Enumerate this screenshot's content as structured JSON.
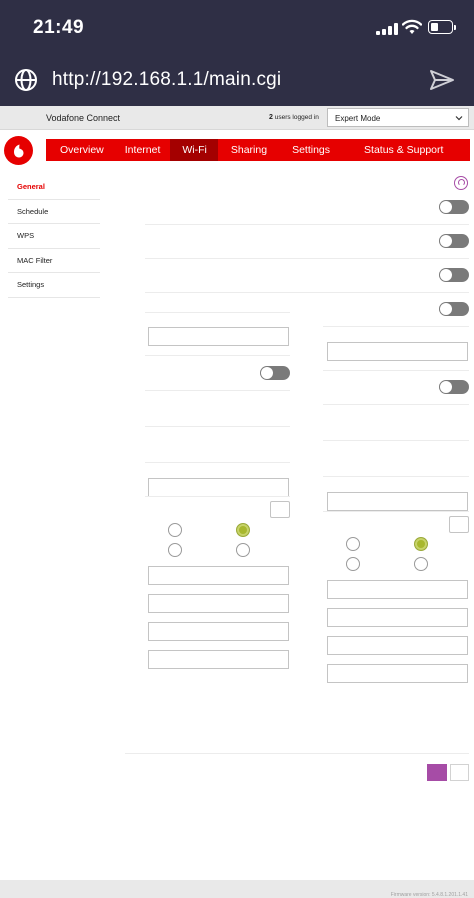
{
  "status_bar": {
    "time": "21:49"
  },
  "browser": {
    "url": "http://192.168.1.1/main.cgi"
  },
  "header": {
    "brand": "Vodafone Connect",
    "users_count": "2",
    "users_text": "users logged in",
    "mode_selected": "Expert Mode"
  },
  "nav": {
    "items": [
      {
        "label": "Overview"
      },
      {
        "label": "Internet"
      },
      {
        "label": "Wi-Fi",
        "active": true
      },
      {
        "label": "Sharing"
      },
      {
        "label": "Settings"
      },
      {
        "label": "Status & Support"
      }
    ]
  },
  "sidebar": {
    "items": [
      {
        "label": "General",
        "active": true
      },
      {
        "label": "Schedule"
      },
      {
        "label": "WPS"
      },
      {
        "label": "MAC Filter"
      },
      {
        "label": "Settings"
      }
    ]
  },
  "footer": {
    "firmware": "Firmware version: 5.4.8.1.201.1.41"
  },
  "colors": {
    "brand_red": "#e60000",
    "active_tab": "#a40000",
    "accent_purple": "#a64ca6",
    "radio_selected": "#a8b82e",
    "toggle_off": "#7a7a7a"
  },
  "icons": [
    "globe-icon",
    "send-icon",
    "signal-icon",
    "wifi-icon",
    "battery-icon",
    "chevron-down-icon",
    "vodafone-logo-icon",
    "help-icon"
  ]
}
